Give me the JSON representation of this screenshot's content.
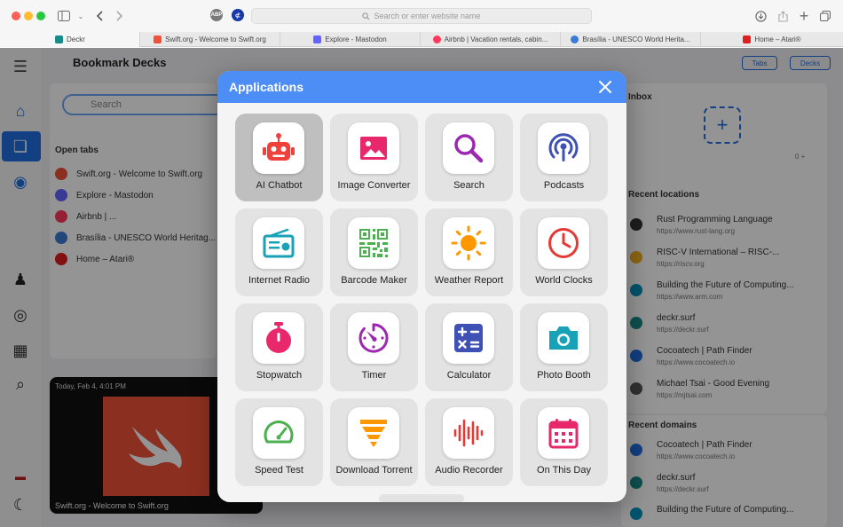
{
  "browser": {
    "address_placeholder": "Search or enter website name",
    "ext_abp": "ABP",
    "tabs": [
      {
        "label": "Deckr",
        "color": "#1a8b8b"
      },
      {
        "label": "Swift.org - Welcome to Swift.org",
        "color": "#f05138"
      },
      {
        "label": "Explore - Mastodon",
        "color": "#6364ff"
      },
      {
        "label": "Airbnb | Vacation rentals, cabin...",
        "color": "#ff385c"
      },
      {
        "label": "Brasília - UNESCO World Herita...",
        "color": "#3a7bd5"
      },
      {
        "label": "Home – Atari®",
        "color": "#e01e1e"
      }
    ]
  },
  "background": {
    "title": "Bookmark Decks",
    "search_placeholder": "Search",
    "open_tabs_label": "Open tabs",
    "open_tabs": [
      "Swift.org - Welcome to Swift.org",
      "Explore - Mastodon",
      "Airbnb | ...",
      "Brasília - UNESCO World Heritag...",
      "Home – Atari®"
    ],
    "inbox_label": "Inbox",
    "recent_locations_label": "Recent locations",
    "recent_locations": [
      {
        "title": "Rust Programming Language",
        "url": "https://www.rust-lang.org"
      },
      {
        "title": "RISC-V International – RISC-...",
        "url": "https://riscv.org"
      },
      {
        "title": "Building the Future of Computing...",
        "url": "https://www.arm.com"
      },
      {
        "title": "deckr.surf",
        "url": "https://deckr.surf"
      },
      {
        "title": "Cocoatech | Path Finder",
        "url": "https://www.cocoatech.io"
      },
      {
        "title": "Michael Tsai - Good Evening",
        "url": "https://mjtsai.com"
      }
    ],
    "recent_domains_label": "Recent domains",
    "recent_domains": [
      {
        "title": "Cocoatech | Path Finder",
        "url": "https://www.cocoatech.io"
      },
      {
        "title": "deckr.surf",
        "url": "https://deckr.surf"
      },
      {
        "title": "Building the Future of Computing...",
        "url": "https://www.arm.com"
      }
    ],
    "btn_tabs": "Tabs",
    "btn_decks": "Decks",
    "card_timestamp": "Today, Feb 4, 4:01 PM",
    "card_caption": "Swift.org - Welcome to Swift.org",
    "inbox_count": "0 +"
  },
  "modal": {
    "title": "Applications",
    "apps": [
      {
        "label": "AI Chatbot",
        "icon": "robot-icon",
        "color": "#f0403c",
        "selected": true
      },
      {
        "label": "Image Converter",
        "icon": "image-icon",
        "color": "#e8286b"
      },
      {
        "label": "Search",
        "icon": "magnifier-icon",
        "color": "#9c27b0"
      },
      {
        "label": "Podcasts",
        "icon": "podcast-icon",
        "color": "#3f51b5"
      },
      {
        "label": "Internet Radio",
        "icon": "radio-icon",
        "color": "#17a2b8"
      },
      {
        "label": "Barcode Maker",
        "icon": "qr-code-icon",
        "color": "#4caf50"
      },
      {
        "label": "Weather Report",
        "icon": "sun-icon",
        "color": "#ff9800"
      },
      {
        "label": "World Clocks",
        "icon": "clock-icon",
        "color": "#e53935"
      },
      {
        "label": "Stopwatch",
        "icon": "stopwatch-icon",
        "color": "#e8286b"
      },
      {
        "label": "Timer",
        "icon": "timer-icon",
        "color": "#9c27b0"
      },
      {
        "label": "Calculator",
        "icon": "calculator-icon",
        "color": "#3f51b5"
      },
      {
        "label": "Photo Booth",
        "icon": "camera-icon",
        "color": "#17a2b8"
      },
      {
        "label": "Speed Test",
        "icon": "speedometer-icon",
        "color": "#4caf50"
      },
      {
        "label": "Download Torrent",
        "icon": "funnel-icon",
        "color": "#ff9800"
      },
      {
        "label": "Audio Recorder",
        "icon": "waveform-icon",
        "color": "#e53935"
      },
      {
        "label": "On This Day",
        "icon": "calendar-icon",
        "color": "#e8286b"
      }
    ]
  }
}
